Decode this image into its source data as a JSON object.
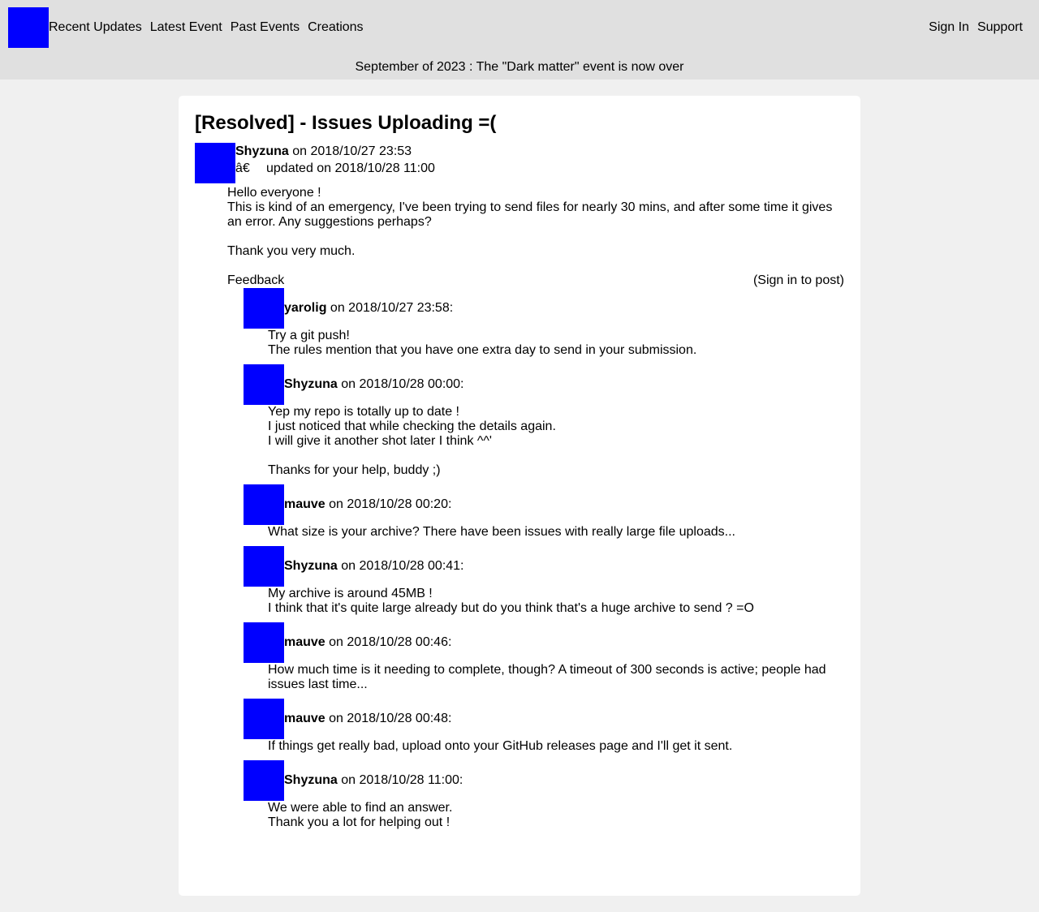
{
  "nav": {
    "left": [
      "Recent Updates",
      "Latest Event",
      "Past Events",
      "Creations"
    ],
    "right": [
      "Sign In",
      "Support"
    ]
  },
  "announcement": "September of 2023 : The \"Dark matter\" event is now over",
  "post": {
    "title": "[Resolved] - Issues Uploading =(",
    "author": "Shyzuna",
    "posted": "on 2018/10/27 23:53",
    "updated_glyph": "â€",
    "updated": "updated on 2018/10/28 11:00",
    "body": [
      "Hello everyone !\nThis is kind of an emergency, I've been trying to send files for nearly 30 mins, and after some time it gives an error. Any suggestions perhaps?",
      "Thank you very much."
    ]
  },
  "feedback": {
    "label": "Feedback",
    "signin": "(Sign in to post)",
    "comments": [
      {
        "author": "yarolig",
        "date": "on 2018/10/27 23:58:",
        "paras": [
          "Try a git push!\nThe rules mention that you have one extra day to send in your submission."
        ]
      },
      {
        "author": "Shyzuna",
        "date": "on 2018/10/28 00:00:",
        "paras": [
          "Yep my repo is totally up to date !\nI just noticed that while checking the details again.\nI will give it another shot later I think ^^'",
          "Thanks for your help, buddy ;)"
        ]
      },
      {
        "author": "mauve",
        "date": "on 2018/10/28 00:20:",
        "paras": [
          "What size is your archive? There have been issues with really large file uploads..."
        ]
      },
      {
        "author": "Shyzuna",
        "date": "on 2018/10/28 00:41:",
        "paras": [
          "My archive is around 45MB !\nI think that it's quite large already but do you think that's a huge archive to send ? =O"
        ]
      },
      {
        "author": "mauve",
        "date": "on 2018/10/28 00:46:",
        "paras": [
          "How much time is it needing to complete, though? A timeout of 300 seconds is active; people had issues last time..."
        ]
      },
      {
        "author": "mauve",
        "date": "on 2018/10/28 00:48:",
        "paras": [
          "If things get really bad, upload onto your GitHub releases page and I'll get it sent."
        ]
      },
      {
        "author": "Shyzuna",
        "date": "on 2018/10/28 11:00:",
        "paras": [
          "We were able to find an answer.\nThank you a lot for helping out !"
        ]
      }
    ]
  }
}
